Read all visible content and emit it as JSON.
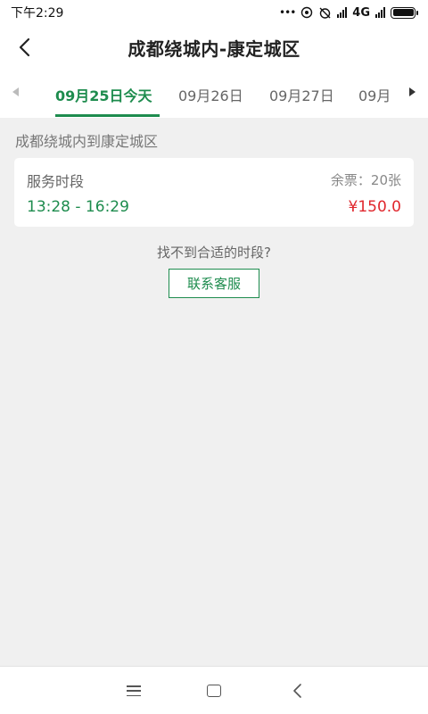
{
  "status_bar": {
    "time": "下午2:29",
    "network": "4G",
    "dots": "•••"
  },
  "header": {
    "title": "成都绕城内-康定城区"
  },
  "date_tabs": [
    {
      "label": "09月25日今天",
      "active": true
    },
    {
      "label": "09月26日",
      "active": false
    },
    {
      "label": "09月27日",
      "active": false
    },
    {
      "label": "09月",
      "active": false
    }
  ],
  "route_label": "成都绕城内到康定城区",
  "service": {
    "title": "服务时段",
    "tickets": "余票：20张",
    "time_range": "13:28 - 16:29",
    "price": "¥150.0"
  },
  "not_found_text": "找不到合适的时段?",
  "contact_button": "联系客服",
  "colors": {
    "accent": "#1e8c4e",
    "price": "#e0272d"
  }
}
